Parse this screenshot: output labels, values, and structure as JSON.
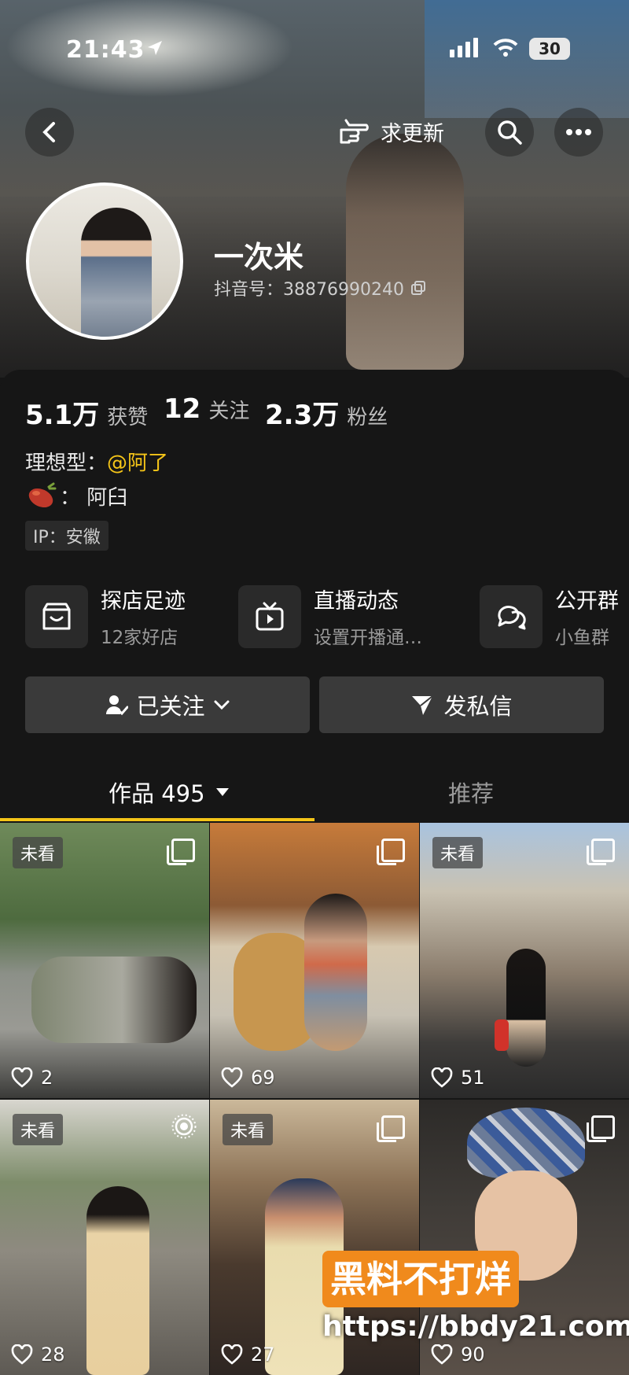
{
  "status_bar": {
    "time": "21:43",
    "battery": "30"
  },
  "top_bar": {
    "request_update_label": "求更新"
  },
  "profile": {
    "name": "一次米",
    "douyin_id_label": "抖音号：38876990240"
  },
  "stats": [
    {
      "value": "5.1万",
      "label": "获赞"
    },
    {
      "value": "12",
      "label": "关注"
    },
    {
      "value": "2.3万",
      "label": "粉丝"
    }
  ],
  "bio": {
    "line1_prefix": "理想型：",
    "line1_mention": "@阿了",
    "line2_text": "：  阿臼"
  },
  "ip_label": "IP：安徽",
  "shortcuts": [
    {
      "title": "探店足迹",
      "subtitle": "12家好店",
      "icon": "store-icon"
    },
    {
      "title": "直播动态",
      "subtitle": "设置开播通…",
      "icon": "tv-icon"
    },
    {
      "title": "公开群",
      "subtitle": "小鱼群",
      "icon": "chat-bubbles-icon"
    }
  ],
  "actions": {
    "follow_label": "已关注",
    "message_label": "发私信"
  },
  "tabs": {
    "works_label": "作品 495",
    "recommend_label": "推荐"
  },
  "grid": [
    {
      "badge": "未看",
      "likes": "2"
    },
    {
      "badge": "",
      "likes": "69"
    },
    {
      "badge": "未看",
      "likes": "51"
    },
    {
      "badge": "未看",
      "likes": "28"
    },
    {
      "badge": "未看",
      "likes": "27"
    },
    {
      "badge": "",
      "likes": "90"
    }
  ],
  "watermark": {
    "brand": "黑料不打烊",
    "url": "https://bbdy21.com"
  },
  "colors": {
    "mention": "#f5c518",
    "accent_underline": "#f5c518",
    "background": "#161616"
  }
}
